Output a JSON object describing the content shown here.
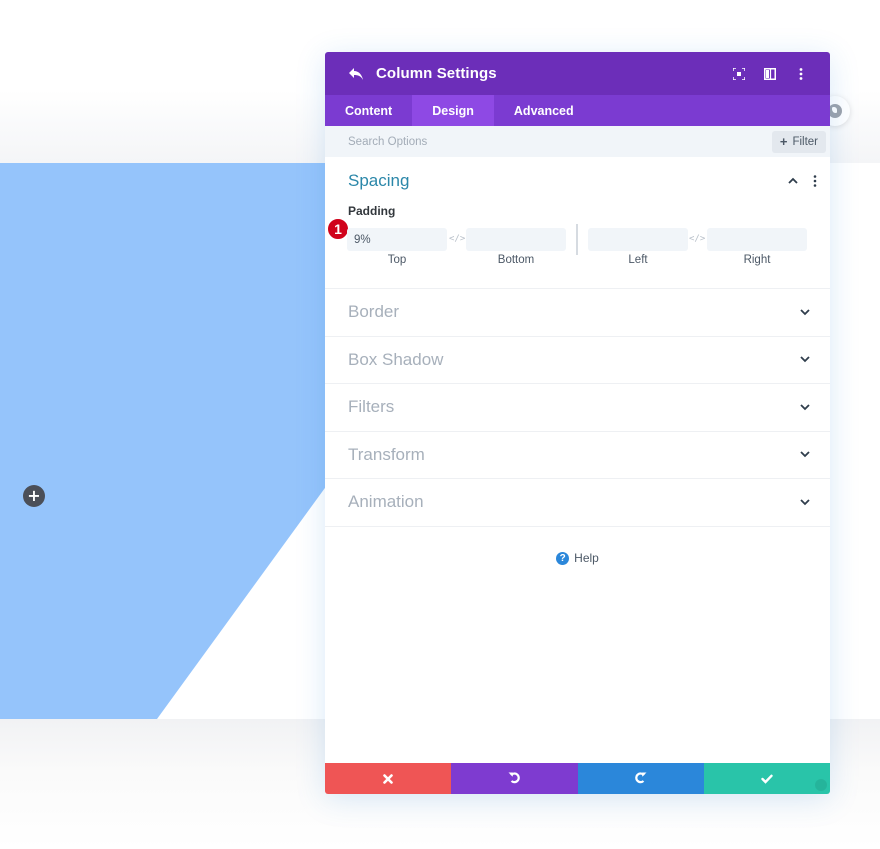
{
  "page": {
    "add_row_icon": "plus-icon",
    "side_icon": "globe-icon",
    "colors": {
      "section_accent": "#95c4fb",
      "header": "#6c2eb9",
      "tabs": "#7b3bd1",
      "tab_active": "#8e49e4",
      "discard": "#ef5555",
      "undo": "#7e3bd0",
      "redo": "#2b87da",
      "save": "#29c4a9",
      "spacing_title": "#2b87a9",
      "badge": "#d0021b"
    }
  },
  "modal": {
    "title": "Column Settings",
    "header_icons": [
      "back-icon",
      "fullscreen-icon",
      "split-view-icon",
      "more-vertical-icon"
    ],
    "tabs": [
      {
        "label": "Content",
        "active": false
      },
      {
        "label": "Design",
        "active": true
      },
      {
        "label": "Advanced",
        "active": false
      }
    ],
    "search": {
      "placeholder": "Search Options",
      "value": "",
      "filter_label": "Filter"
    },
    "spacing": {
      "title": "Spacing",
      "expanded": true,
      "padding": {
        "label": "Padding",
        "badge": "1",
        "fields": [
          {
            "label": "Top",
            "value": "9%"
          },
          {
            "label": "Bottom",
            "value": ""
          },
          {
            "label": "Left",
            "value": ""
          },
          {
            "label": "Right",
            "value": ""
          }
        ]
      }
    },
    "groups": [
      {
        "title": "Border"
      },
      {
        "title": "Box Shadow"
      },
      {
        "title": "Filters"
      },
      {
        "title": "Transform"
      },
      {
        "title": "Animation"
      }
    ],
    "help_label": "Help",
    "footer": {
      "discard_icon": "close-icon",
      "undo_icon": "undo-icon",
      "redo_icon": "redo-icon",
      "save_icon": "check-icon"
    }
  }
}
